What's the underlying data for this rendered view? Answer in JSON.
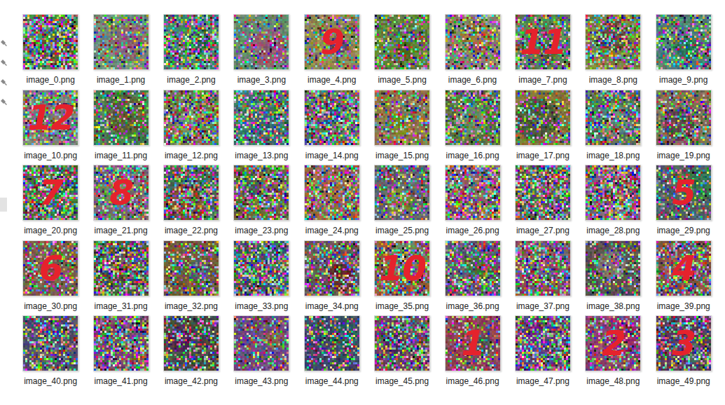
{
  "items": [
    {
      "label": "image_0.png"
    },
    {
      "label": "image_1.png"
    },
    {
      "label": "image_2.png"
    },
    {
      "label": "image_3.png"
    },
    {
      "label": "image_4.png",
      "annotation": "9"
    },
    {
      "label": "image_5.png"
    },
    {
      "label": "image_6.png"
    },
    {
      "label": "image_7.png",
      "annotation": "11"
    },
    {
      "label": "image_8.png"
    },
    {
      "label": "image_9.png"
    },
    {
      "label": "image_10.png",
      "annotation": "12"
    },
    {
      "label": "image_11.png"
    },
    {
      "label": "image_12.png"
    },
    {
      "label": "image_13.png"
    },
    {
      "label": "image_14.png"
    },
    {
      "label": "image_15.png"
    },
    {
      "label": "image_16.png"
    },
    {
      "label": "image_17.png"
    },
    {
      "label": "image_18.png"
    },
    {
      "label": "image_19.png"
    },
    {
      "label": "image_20.png",
      "annotation": "7"
    },
    {
      "label": "image_21.png",
      "annotation": "8"
    },
    {
      "label": "image_22.png"
    },
    {
      "label": "image_23.png"
    },
    {
      "label": "image_24.png"
    },
    {
      "label": "image_25.png"
    },
    {
      "label": "image_26.png"
    },
    {
      "label": "image_27.png"
    },
    {
      "label": "image_28.png"
    },
    {
      "label": "image_29.png",
      "annotation": "5"
    },
    {
      "label": "image_30.png",
      "annotation": "6"
    },
    {
      "label": "image_31.png"
    },
    {
      "label": "image_32.png"
    },
    {
      "label": "image_33.png"
    },
    {
      "label": "image_34.png"
    },
    {
      "label": "image_35.png",
      "annotation": "10"
    },
    {
      "label": "image_36.png"
    },
    {
      "label": "image_37.png"
    },
    {
      "label": "image_38.png"
    },
    {
      "label": "image_39.png",
      "annotation": "4"
    },
    {
      "label": "image_40.png"
    },
    {
      "label": "image_41.png"
    },
    {
      "label": "image_42.png"
    },
    {
      "label": "image_43.png"
    },
    {
      "label": "image_44.png"
    },
    {
      "label": "image_45.png"
    },
    {
      "label": "image_46.png",
      "annotation": "1"
    },
    {
      "label": "image_47.png"
    },
    {
      "label": "image_48.png",
      "annotation": "2"
    },
    {
      "label": "image_49.png",
      "annotation": "3"
    }
  ]
}
